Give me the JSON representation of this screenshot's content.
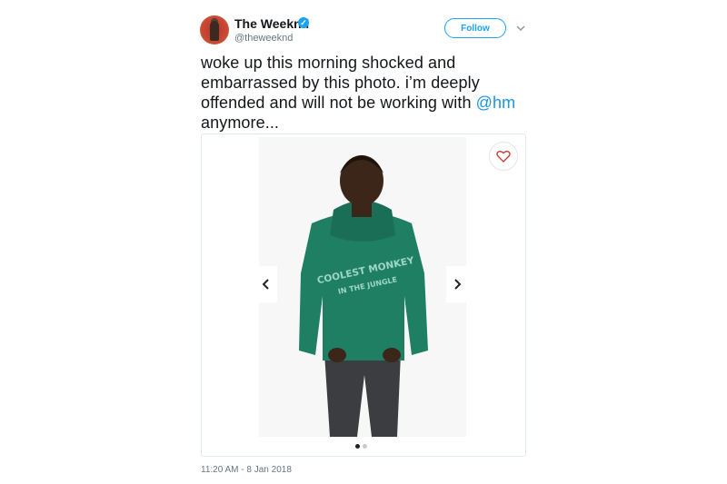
{
  "user": {
    "display_name": "The Weeknd",
    "handle": "@theweeknd",
    "verified_icon": "verified-badge-icon"
  },
  "actions": {
    "follow_label": "Follow",
    "more_icon": "chevron-down-icon"
  },
  "tweet": {
    "text_before": "woke up this morning shocked and embarrassed by this photo. i’m deeply offended and will not be working with ",
    "mention": "@hm",
    "text_after": " anymore..."
  },
  "media": {
    "hoodie_text_line1": "COOLEST MONKEY",
    "hoodie_text_line2": "IN THE JUNGLE",
    "carousel_position": 1,
    "carousel_total": 2,
    "like_icon": "heart-icon",
    "prev_icon": "chevron-left-icon",
    "next_icon": "chevron-right-icon"
  },
  "timestamp": "11:20 AM - 8 Jan 2018",
  "colors": {
    "accent": "#1da1f2",
    "mention": "#1b95e0",
    "hoodie": "#1f7f63",
    "muted_text": "#657786"
  }
}
